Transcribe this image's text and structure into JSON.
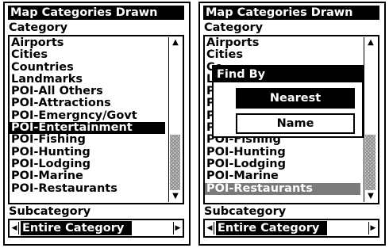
{
  "left": {
    "title": "Map Categories Drawn",
    "category_label": "Category",
    "categories": [
      "Airports",
      "Cities",
      "Countries",
      "Landmarks",
      "POI-All Others",
      "POI-Attractions",
      "POI-Emergncy/Govt",
      "POI-Entertainment",
      "POI-Fishing",
      "POI-Hunting",
      "POI-Lodging",
      "POI-Marine",
      "POI-Restaurants"
    ],
    "selected_category": "POI-Entertainment",
    "subcategory_label": "Subcategory",
    "subcategory_value": "Entire Category"
  },
  "right": {
    "title": "Map Categories Drawn",
    "category_label": "Category",
    "categories": [
      "Airports",
      "Cities",
      "Co",
      "Lan",
      "PO",
      "PO",
      "PO",
      "POI-Entertainment",
      "POI-Fishing",
      "POI-Hunting",
      "POI-Lodging",
      "POI-Marine",
      "POI-Restaurants"
    ],
    "selected_category": "POI-Restaurants",
    "subcategory_label": "Subcategory",
    "subcategory_value": "Entire Category",
    "popup": {
      "title": "Find By",
      "buttons": [
        "Nearest",
        "Name"
      ],
      "selected_button": "Nearest"
    }
  },
  "colors": {
    "highlight": "#000000",
    "inactive_highlight": "#7a7a7a",
    "background": "#ffffff"
  }
}
